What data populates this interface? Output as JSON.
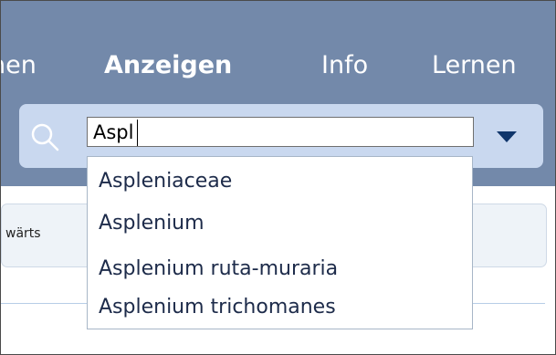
{
  "nav": {
    "items": [
      {
        "label": "nen"
      },
      {
        "label": "Anzeigen"
      },
      {
        "label": "Info"
      },
      {
        "label": "Lernen"
      }
    ]
  },
  "search": {
    "value": "Aspl",
    "icon": "search-icon",
    "dropdown_icon": "chevron-down-icon"
  },
  "suggestions": [
    "Aspleniaceae",
    "Asplenium",
    "Asplenium ruta-muraria",
    "Asplenium trichomanes"
  ],
  "toolbar": {
    "label": "wärts"
  },
  "colors": {
    "header": "#7389aa",
    "searchbar": "#c9d8ef",
    "accent": "#10366b",
    "toolbar": "#eef3f8"
  }
}
